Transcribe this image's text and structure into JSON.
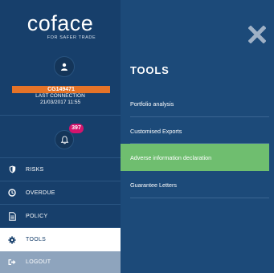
{
  "brand": {
    "logo_text": "coface",
    "tagline": "FOR SAFER TRADE"
  },
  "user": {
    "code": "CG149471",
    "last_connection_label": "LAST CONNECTION",
    "last_connection_date": "21/03/2017 11:55"
  },
  "notifications": {
    "count": "397"
  },
  "nav": {
    "items": [
      {
        "label": "RISKS",
        "icon": "shield-icon"
      },
      {
        "label": "OVERDUE",
        "icon": "clock-icon"
      },
      {
        "label": "POLICY",
        "icon": "document-icon"
      },
      {
        "label": "TOOLS",
        "icon": "gear-icon",
        "active": true
      },
      {
        "label": "LOGOUT",
        "icon": "logout-icon"
      }
    ]
  },
  "panel": {
    "title": "TOOLS",
    "menu": [
      {
        "label": "Portfolio analysis"
      },
      {
        "label": "Customised Exports"
      },
      {
        "label": "Adverse information declaration",
        "highlighted": true
      },
      {
        "label": "Guarantee Letters"
      }
    ]
  },
  "colors": {
    "sidebar_bg": "#173f6b",
    "panel_bg": "#1c4a79",
    "user_code_bg": "#e57328",
    "badge_bg": "#d4146d",
    "highlight_bg": "#6fbe6f",
    "logout_bg": "#8ea4bd"
  }
}
